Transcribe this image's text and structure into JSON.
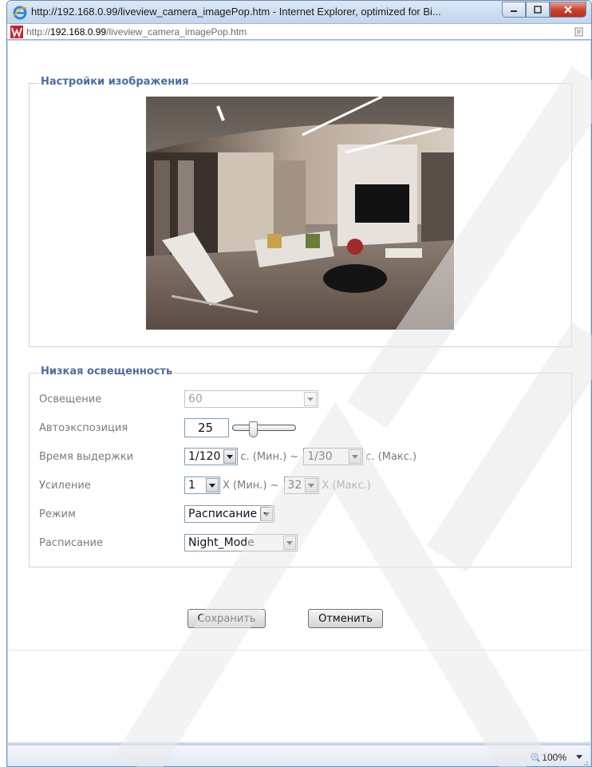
{
  "window": {
    "title": "http://192.168.0.99/liveview_camera_imagePop.htm - Internet Explorer, optimized for Bi...",
    "address_prefix": "http://",
    "address_host": "192.168.0.99",
    "address_path": "/liveview_camera_imagePop.htm"
  },
  "image_settings": {
    "legend": "Настройки изображения"
  },
  "low_light": {
    "legend": "Низкая освещенность",
    "illumination": {
      "label": "Освещение",
      "value": "60"
    },
    "auto_exposure": {
      "label": "Автоэкспозиция",
      "value": "25",
      "slider_level": 0.3
    },
    "exposure_time": {
      "label": "Время выдержки",
      "min_value": "1/120",
      "min_unit": "с.  (Мин.) ~",
      "max_value": "1/30",
      "max_unit": "с.  (Макс.)"
    },
    "gain": {
      "label": "Усиление",
      "min_value": "1",
      "min_unit": "X  (Мин.) ~",
      "max_value": "32",
      "max_unit": "X  (Макс.)"
    },
    "mode": {
      "label": "Режим",
      "value": "Расписание"
    },
    "schedule": {
      "label": "Расписание",
      "value": "Night_Mode"
    }
  },
  "buttons": {
    "save": "Сохранить",
    "cancel": "Отменить"
  },
  "statusbar": {
    "zoom": "100%"
  },
  "icons": {
    "browser": "ie-icon",
    "site": "site-icon",
    "compat": "compatibility-view-icon",
    "zoom": "zoom-icon"
  }
}
